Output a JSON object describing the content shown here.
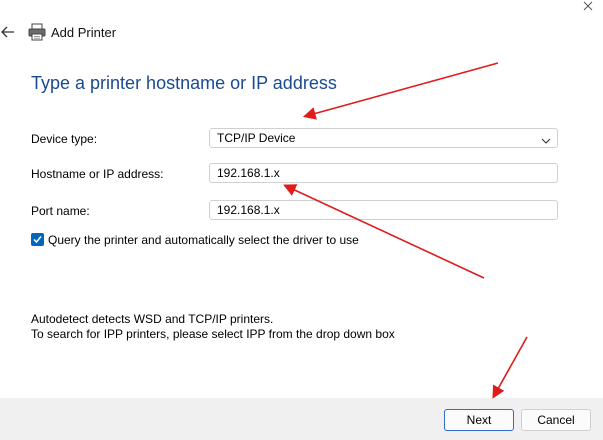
{
  "window": {
    "title": "Add Printer"
  },
  "page": {
    "heading": "Type a printer hostname or IP address"
  },
  "form": {
    "device_type_label": "Device type:",
    "device_type_value": "TCP/IP Device",
    "hostname_label": "Hostname or IP address:",
    "hostname_value": "192.168.1.x",
    "port_label": "Port name:",
    "port_value": "192.168.1.x",
    "query_checkbox_label": "Query the printer and automatically select the driver to use",
    "query_checked": true
  },
  "info": {
    "line1": "Autodetect detects WSD and TCP/IP printers.",
    "line2": "To search for IPP printers, please select IPP from the drop down box"
  },
  "buttons": {
    "next": "Next",
    "cancel": "Cancel"
  },
  "colors": {
    "heading": "#1a4b8f",
    "accent": "#0067c0",
    "annotation_arrow": "#e01b1b"
  },
  "icons": {
    "back": "back-arrow-icon",
    "printer": "printer-icon",
    "dropdown": "chevron-down-icon",
    "close": "close-icon"
  }
}
